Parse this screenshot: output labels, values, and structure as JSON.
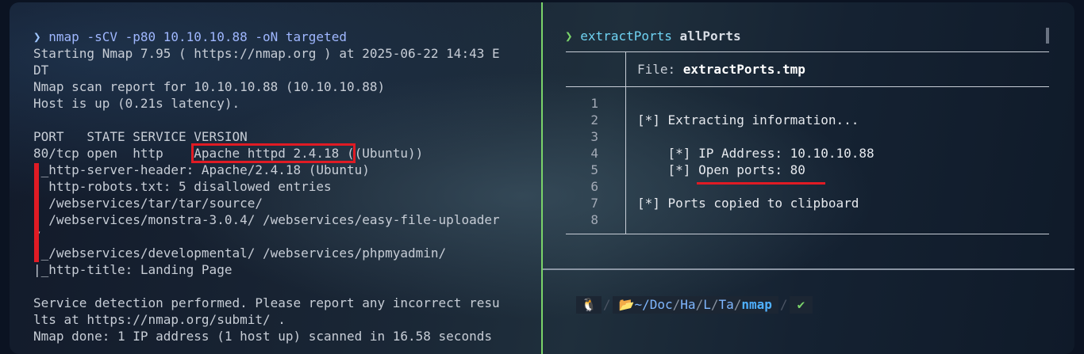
{
  "left_terminal": {
    "prompt_symbol": "❯",
    "command": "nmap -sCV -p80 10.10.10.88 -oN targeted",
    "lines": [
      "Starting Nmap 7.95 ( https://nmap.org ) at 2025-06-22 14:43 E",
      "DT",
      "Nmap scan report for 10.10.10.88 (10.10.10.88)",
      "Host is up (0.21s latency).",
      "",
      "PORT   STATE SERVICE VERSION",
      "80/tcp open  http    Apache httpd 2.4.18 ((Ubuntu))",
      "|_http-server-header: Apache/2.4.18 (Ubuntu)",
      "| http-robots.txt: 5 disallowed entries",
      "| /webservices/tar/tar/source/",
      "| /webservices/monstra-3.0.4/ /webservices/easy-file-uploader",
      "/",
      "|_/webservices/developmental/ /webservices/phpmyadmin/",
      "|_http-title: Landing Page",
      "",
      "Service detection performed. Please report any incorrect resu",
      "lts at https://nmap.org/submit/ .",
      "Nmap done: 1 IP address (1 host up) scanned in 16.58 seconds"
    ]
  },
  "right_terminal": {
    "prompt_symbol": "❯",
    "command_name": "extractPorts",
    "command_arg": "allPorts",
    "file_label": "File: ",
    "file_name": "extractPorts.tmp",
    "line_numbers": [
      "1",
      "2",
      "3",
      "4",
      "5",
      "6",
      "7",
      "8"
    ],
    "content_lines": [
      "",
      "[*] Extracting information...",
      "",
      "    [*] IP Address: 10.10.10.88",
      "    [*] Open ports: 80",
      "",
      "[*] Ports copied to clipboard",
      ""
    ]
  },
  "status_bar": {
    "os_icon": "🐧",
    "folder_icon": "📂",
    "path_prefix": "~/",
    "path_dirs": [
      "Doc",
      "Ha",
      "L",
      "Ta"
    ],
    "path_current": "nmap",
    "ok_symbol": "✔"
  },
  "colors": {
    "highlight_red": "#e01b24",
    "divider_green": "#7ad36a",
    "path_blue": "#4fb0ff"
  }
}
